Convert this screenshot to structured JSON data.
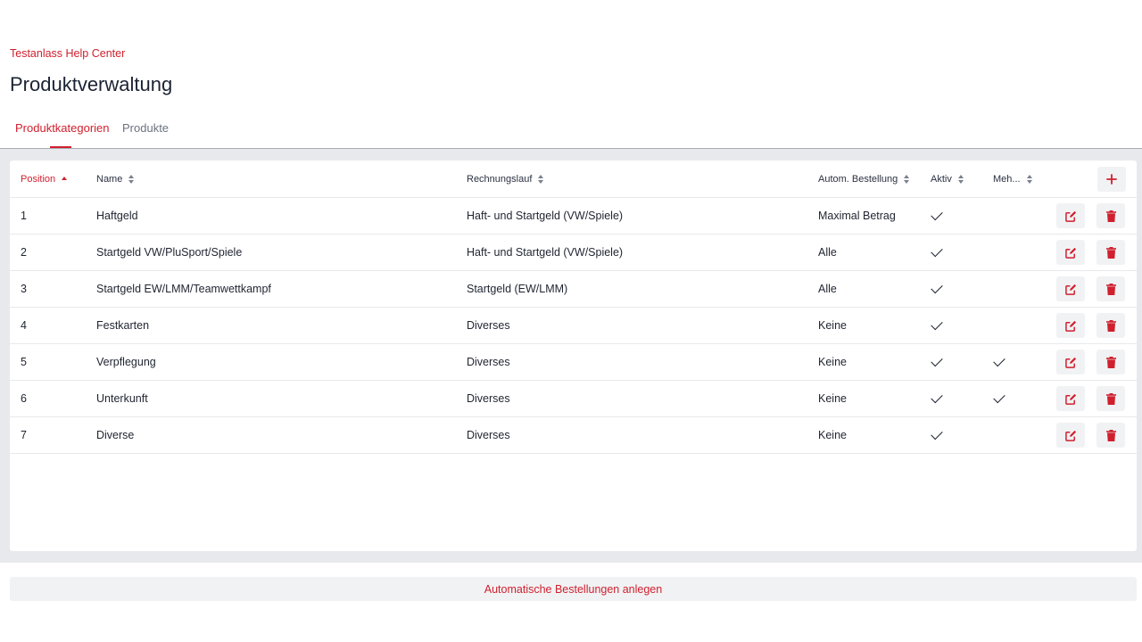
{
  "header": {
    "breadcrumb": "Testanlass Help Center",
    "title": "Produktverwaltung"
  },
  "tabs": [
    {
      "label": "Produktkategorien",
      "active": true
    },
    {
      "label": "Produkte",
      "active": false
    }
  ],
  "table": {
    "columns": [
      {
        "label": "Position",
        "sorted": "asc"
      },
      {
        "label": "Name"
      },
      {
        "label": "Rechnungslauf"
      },
      {
        "label": "Autom. Bestellung"
      },
      {
        "label": "Aktiv"
      },
      {
        "label": "Meh..."
      }
    ],
    "add_icon": "plus-icon",
    "rows": [
      {
        "position": "1",
        "name": "Haftgeld",
        "rechnungslauf": "Haft- und Startgeld (VW/Spiele)",
        "autom_bestellung": "Maximal Betrag",
        "aktiv": true,
        "mehrfach": false
      },
      {
        "position": "2",
        "name": "Startgeld VW/PluSport/Spiele",
        "rechnungslauf": "Haft- und Startgeld (VW/Spiele)",
        "autom_bestellung": "Alle",
        "aktiv": true,
        "mehrfach": false
      },
      {
        "position": "3",
        "name": "Startgeld EW/LMM/Teamwettkampf",
        "rechnungslauf": "Startgeld (EW/LMM)",
        "autom_bestellung": "Alle",
        "aktiv": true,
        "mehrfach": false
      },
      {
        "position": "4",
        "name": "Festkarten",
        "rechnungslauf": "Diverses",
        "autom_bestellung": "Keine",
        "aktiv": true,
        "mehrfach": false
      },
      {
        "position": "5",
        "name": "Verpflegung",
        "rechnungslauf": "Diverses",
        "autom_bestellung": "Keine",
        "aktiv": true,
        "mehrfach": true
      },
      {
        "position": "6",
        "name": "Unterkunft",
        "rechnungslauf": "Diverses",
        "autom_bestellung": "Keine",
        "aktiv": true,
        "mehrfach": true
      },
      {
        "position": "7",
        "name": "Diverse",
        "rechnungslauf": "Diverses",
        "autom_bestellung": "Keine",
        "aktiv": true,
        "mehrfach": false
      }
    ],
    "row_action_icons": [
      "edit-icon",
      "trash-icon"
    ]
  },
  "footer": {
    "button_label": "Automatische Bestellungen anlegen"
  },
  "colors": {
    "accent": "#d0202e",
    "panel_bg": "#e8e9ec",
    "button_bg": "#f1f2f4"
  }
}
